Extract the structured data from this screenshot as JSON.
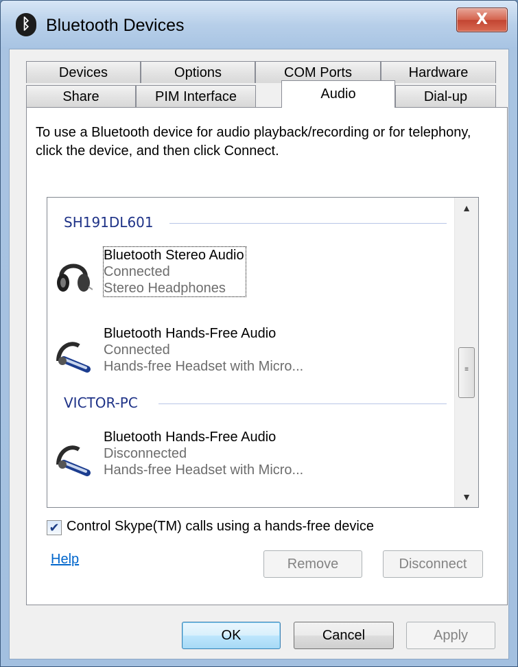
{
  "window": {
    "title": "Bluetooth Devices",
    "close_label": "X"
  },
  "tabs_back": [
    "Devices",
    "Options",
    "COM Ports",
    "Hardware"
  ],
  "tabs_front": [
    "Share",
    "PIM Interface",
    "Audio",
    "Dial-up"
  ],
  "active_tab": "Audio",
  "instructions": "To use a Bluetooth device for audio playback/recording or for telephony, click the device, and then click Connect.",
  "groups": [
    {
      "name": "SH191DL601",
      "devices": [
        {
          "name": "Bluetooth Stereo Audio",
          "status": "Connected",
          "type": "Stereo Headphones",
          "icon": "headphones-icon"
        },
        {
          "name": "Bluetooth Hands-Free Audio",
          "status": "Connected",
          "type": "Hands-free Headset with Micro...",
          "icon": "headset-icon"
        }
      ]
    },
    {
      "name": "VICTOR-PC",
      "devices": [
        {
          "name": "Bluetooth Hands-Free Audio",
          "status": "Disconnected",
          "type": "Hands-free Headset with Micro...",
          "icon": "headset-icon"
        }
      ]
    }
  ],
  "checkbox": {
    "label": "Control Skype(TM) calls using a hands-free device",
    "checked": true
  },
  "help_link": "Help",
  "buttons": {
    "remove": "Remove",
    "disconnect": "Disconnect",
    "ok": "OK",
    "cancel": "Cancel",
    "apply": "Apply"
  },
  "colors": {
    "group_header": "#1e3287",
    "link": "#0066cc",
    "titlebar": "#b7cfe9"
  }
}
